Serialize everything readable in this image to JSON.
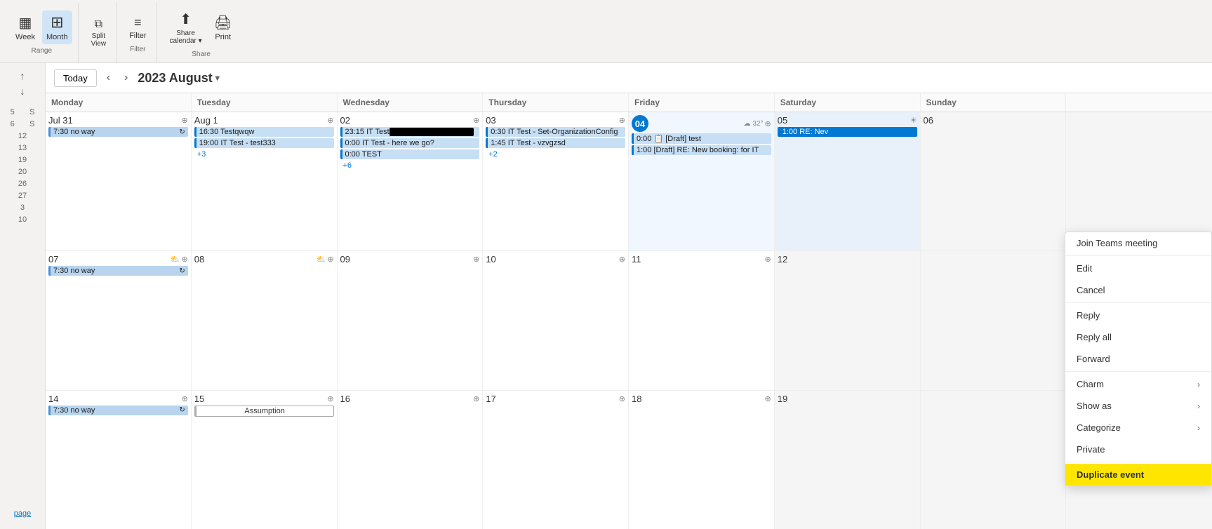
{
  "toolbar": {
    "groups": [
      {
        "label": "Range",
        "buttons": [
          {
            "id": "week-btn",
            "icon": "▦",
            "label": "Week",
            "active": false
          },
          {
            "id": "month-btn",
            "icon": "⊞",
            "label": "Month",
            "active": true
          }
        ]
      },
      {
        "label": "",
        "buttons": [
          {
            "id": "split-btn",
            "icon": "⧉",
            "label": "Split\nView",
            "active": false
          }
        ]
      },
      {
        "label": "Filter",
        "buttons": [
          {
            "id": "filter-btn",
            "icon": "≡",
            "label": "Filter",
            "active": false
          }
        ]
      },
      {
        "label": "Share",
        "buttons": [
          {
            "id": "share-calendar-btn",
            "icon": "↑",
            "label": "Share\ncalendar ▾",
            "active": false
          },
          {
            "id": "print-btn",
            "icon": "🖨",
            "label": "Print",
            "active": false
          }
        ]
      }
    ]
  },
  "sidebar": {
    "up_arrow": "↑",
    "down_arrow": "↓",
    "week_rows": [
      {
        "week": "5",
        "s": "S"
      },
      {
        "week": "6",
        "s": "S"
      },
      {
        "week": "12",
        "s": ""
      },
      {
        "week": "13",
        "s": ""
      },
      {
        "week": "19",
        "s": ""
      },
      {
        "week": "20",
        "s": ""
      },
      {
        "week": "26",
        "s": ""
      },
      {
        "week": "27",
        "s": ""
      },
      {
        "week": "3",
        "s": ""
      },
      {
        "week": "10",
        "s": ""
      }
    ],
    "page_link": "page"
  },
  "calendar": {
    "today_btn": "Today",
    "nav_prev": "‹",
    "nav_next": "›",
    "title": "2023 August",
    "dropdown_arrow": "▾",
    "day_headers": [
      "Monday",
      "Tuesday",
      "Wednesday",
      "Thursday",
      "Friday",
      "Saturday",
      "Sunday"
    ],
    "rows": [
      {
        "week_num": "5",
        "cells": [
          {
            "date": "Jul 31",
            "date_icon": "⊕",
            "events": [
              {
                "text": "7:30 no way",
                "type": "recurring",
                "span": true
              }
            ]
          },
          {
            "date": "Aug 1",
            "date_icon": "⊕",
            "events": [
              {
                "text": "16:30 Testqwqw",
                "type": "normal"
              },
              {
                "text": "19:00 IT Test - test333",
                "type": "normal"
              },
              {
                "more": "+3"
              }
            ]
          },
          {
            "date": "02",
            "date_icon": "⊕",
            "events": [
              {
                "text": "23:15 IT Test ",
                "type": "redacted"
              },
              {
                "text": "0:00 IT Test - here we go?",
                "type": "normal"
              },
              {
                "text": "0:00 TEST",
                "type": "normal"
              },
              {
                "more": "+6"
              }
            ]
          },
          {
            "date": "03",
            "date_icon": "⊕",
            "events": [
              {
                "text": "0:30 IT Test - Set-OrganizationConfig",
                "type": "normal"
              },
              {
                "text": "1:45 IT Test - vzvgzsd",
                "type": "normal"
              },
              {
                "more": "+2"
              }
            ]
          },
          {
            "date": "04",
            "date_icon": "⊕",
            "today": true,
            "weather": "☁ 32°",
            "events": [
              {
                "text": "0:00 📋 [Draft] test",
                "type": "normal"
              },
              {
                "text": "1:00 [Draft] RE: New booking: for IT",
                "type": "normal"
              }
            ]
          },
          {
            "date": "05",
            "date_icon": "☀",
            "events": [
              {
                "text": "1:00 RE: Nev",
                "type": "selected"
              }
            ]
          },
          {
            "date": "06",
            "date_icon": "",
            "events": []
          }
        ]
      },
      {
        "week_num": "6",
        "cells": [
          {
            "date": "07",
            "date_icon": "⊕",
            "weather_icon": "⛅",
            "events": [
              {
                "text": "7:30 no way",
                "type": "recurring",
                "span": true
              }
            ]
          },
          {
            "date": "08",
            "date_icon": "⊕",
            "weather_icon": "⛅",
            "events": []
          },
          {
            "date": "09",
            "date_icon": "⊕",
            "events": []
          },
          {
            "date": "10",
            "date_icon": "⊕",
            "events": []
          },
          {
            "date": "11",
            "date_icon": "⊕",
            "events": []
          },
          {
            "date": "12",
            "date_icon": "",
            "events": []
          },
          {
            "date": "",
            "date_icon": "",
            "events": []
          }
        ]
      },
      {
        "week_num": "3",
        "cells": [
          {
            "date": "14",
            "date_icon": "⊕",
            "events": [
              {
                "text": "7:30 no way",
                "type": "recurring",
                "span": true
              }
            ]
          },
          {
            "date": "15",
            "date_icon": "⊕",
            "events": [
              {
                "text": "Assumption",
                "type": "outline"
              }
            ]
          },
          {
            "date": "16",
            "date_icon": "⊕",
            "events": []
          },
          {
            "date": "17",
            "date_icon": "⊕",
            "events": []
          },
          {
            "date": "18",
            "date_icon": "⊕",
            "events": []
          },
          {
            "date": "19",
            "date_icon": "",
            "events": []
          },
          {
            "date": "",
            "date_icon": "",
            "events": []
          }
        ]
      }
    ]
  },
  "context_menu": {
    "items": [
      {
        "id": "join-teams",
        "label": "Join Teams meeting",
        "has_arrow": false
      },
      {
        "id": "edit",
        "label": "Edit",
        "has_arrow": false
      },
      {
        "id": "cancel",
        "label": "Cancel",
        "has_arrow": false
      },
      {
        "id": "reply",
        "label": "Reply",
        "has_arrow": false
      },
      {
        "id": "reply-all",
        "label": "Reply all",
        "has_arrow": false
      },
      {
        "id": "forward",
        "label": "Forward",
        "has_arrow": false
      },
      {
        "id": "charm",
        "label": "Charm",
        "has_arrow": true
      },
      {
        "id": "show-as",
        "label": "Show as",
        "has_arrow": true
      },
      {
        "id": "categorize",
        "label": "Categorize",
        "has_arrow": true
      },
      {
        "id": "private",
        "label": "Private",
        "has_arrow": false
      },
      {
        "id": "duplicate-event",
        "label": "Duplicate event",
        "has_arrow": false,
        "highlight": true
      }
    ]
  }
}
